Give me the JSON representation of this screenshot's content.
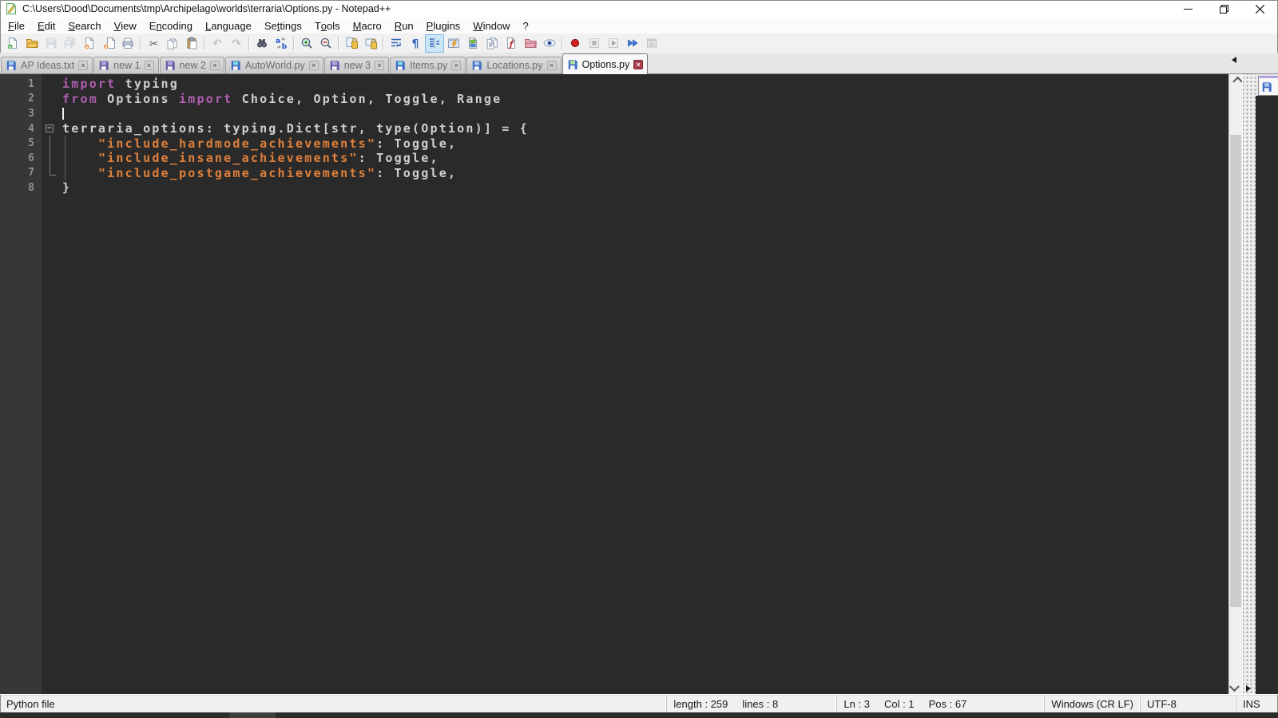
{
  "window": {
    "title": "C:\\Users\\Dood\\Documents\\tmp\\Archipelago\\worlds\\terraria\\Options.py - Notepad++",
    "controls": [
      "minimize-button",
      "restore-button",
      "close-button"
    ]
  },
  "menubar": {
    "items": [
      {
        "label": "File",
        "mnemonic": 0
      },
      {
        "label": "Edit",
        "mnemonic": 0
      },
      {
        "label": "Search",
        "mnemonic": 0
      },
      {
        "label": "View",
        "mnemonic": 0
      },
      {
        "label": "Encoding",
        "mnemonic": 1
      },
      {
        "label": "Language",
        "mnemonic": 0
      },
      {
        "label": "Settings",
        "mnemonic": 2
      },
      {
        "label": "Tools",
        "mnemonic": 1
      },
      {
        "label": "Macro",
        "mnemonic": 0
      },
      {
        "label": "Run",
        "mnemonic": 0
      },
      {
        "label": "Plugins",
        "mnemonic": 0
      },
      {
        "label": "Window",
        "mnemonic": 0
      },
      {
        "label": "?",
        "mnemonic": -1
      }
    ]
  },
  "toolbar": {
    "items": [
      {
        "icon": "new-file"
      },
      {
        "icon": "open-file"
      },
      {
        "icon": "save-file",
        "disabled": true
      },
      {
        "icon": "save-all",
        "disabled": true
      },
      {
        "icon": "close-file"
      },
      {
        "icon": "close-all"
      },
      {
        "icon": "print"
      },
      {
        "sep": true
      },
      {
        "icon": "cut"
      },
      {
        "icon": "copy"
      },
      {
        "icon": "paste"
      },
      {
        "sep": true
      },
      {
        "icon": "undo",
        "disabled": true
      },
      {
        "icon": "redo",
        "disabled": true
      },
      {
        "sep": true
      },
      {
        "icon": "find"
      },
      {
        "icon": "replace"
      },
      {
        "sep": true
      },
      {
        "icon": "zoom-in"
      },
      {
        "icon": "zoom-out"
      },
      {
        "sep": true
      },
      {
        "icon": "sync-vertical"
      },
      {
        "icon": "sync-horizontal"
      },
      {
        "sep": true
      },
      {
        "icon": "word-wrap"
      },
      {
        "icon": "show-all-characters"
      },
      {
        "icon": "show-indent-guide",
        "active": true
      },
      {
        "icon": "udl-dialog"
      },
      {
        "icon": "document-map"
      },
      {
        "icon": "document-list"
      },
      {
        "icon": "function-list"
      },
      {
        "icon": "folder-as-workspace"
      },
      {
        "icon": "monitoring"
      },
      {
        "sep": true
      },
      {
        "icon": "macro-record"
      },
      {
        "icon": "macro-stop",
        "disabled": true
      },
      {
        "icon": "macro-play",
        "disabled": true
      },
      {
        "icon": "macro-run-multiple"
      },
      {
        "icon": "macro-save",
        "disabled": true
      }
    ]
  },
  "tabbar": {
    "tabs": [
      {
        "label": "AP Ideas.txt",
        "floppy": "blue",
        "active": false
      },
      {
        "label": "new 1",
        "floppy": "purple",
        "active": false
      },
      {
        "label": "new 2",
        "floppy": "purple",
        "active": false
      },
      {
        "label": "AutoWorld.py",
        "floppy": "teal",
        "active": false
      },
      {
        "label": "new 3",
        "floppy": "purple",
        "active": false
      },
      {
        "label": "Items.py",
        "floppy": "teal",
        "active": false
      },
      {
        "label": "Locations.py",
        "floppy": "blue",
        "active": false
      },
      {
        "label": "Options.py",
        "floppy": "green",
        "active": true
      }
    ],
    "close_glyph": "×"
  },
  "editor": {
    "caret_line": 3,
    "lines": [
      {
        "num": "1",
        "tokens": [
          {
            "t": "import",
            "c": "kw"
          },
          {
            "t": " typing",
            "c": "def"
          }
        ]
      },
      {
        "num": "2",
        "tokens": [
          {
            "t": "from",
            "c": "kw"
          },
          {
            "t": " Options ",
            "c": "def"
          },
          {
            "t": "import",
            "c": "kw"
          },
          {
            "t": " Choice, Option, Toggle, Range",
            "c": "def"
          }
        ]
      },
      {
        "num": "3",
        "tokens": []
      },
      {
        "num": "4",
        "fold": "start",
        "tokens": [
          {
            "t": "terraria_options: typing.Dict[str, type(Option)] = {",
            "c": "def"
          }
        ]
      },
      {
        "num": "5",
        "fold": "line",
        "tokens": [
          {
            "t": "    ",
            "c": "def"
          },
          {
            "t": "\"include_hardmode_achievements\"",
            "c": "str"
          },
          {
            "t": ": Toggle,",
            "c": "def"
          }
        ]
      },
      {
        "num": "6",
        "fold": "line",
        "tokens": [
          {
            "t": "    ",
            "c": "def"
          },
          {
            "t": "\"include_insane_achievements\"",
            "c": "str"
          },
          {
            "t": ": Toggle,",
            "c": "def"
          }
        ]
      },
      {
        "num": "7",
        "fold": "end",
        "tokens": [
          {
            "t": "    ",
            "c": "def"
          },
          {
            "t": "\"include_postgame_achievements\"",
            "c": "str"
          },
          {
            "t": ": Toggle,",
            "c": "def"
          }
        ]
      },
      {
        "num": "8",
        "tokens": [
          {
            "t": "}",
            "c": "def"
          }
        ]
      }
    ],
    "fold_minus_glyph": "−"
  },
  "statusbar": {
    "doc_type": "Python file",
    "length_lines": "length : 259     lines : 8",
    "cursor": "Ln : 3     Col : 1     Pos : 67",
    "eol": "Windows (CR LF)",
    "encoding": "UTF-8",
    "typing_mode": "INS"
  },
  "colors": {
    "editor_bg": "#2a2a2a",
    "gutter_bg": "#373737",
    "keyword": "#b05eb0",
    "identifier": "#d0d0d0",
    "string": "#e0803a",
    "accent_active_tab_topbar": "#b2a1dd",
    "floppy": {
      "blue": {
        "body": "#3f6cc4",
        "label": "#a9cbf0"
      },
      "purple": {
        "body": "#6b5ba6",
        "label": "#b4a6dc"
      },
      "teal": {
        "body": "#3f6cc4",
        "label": "#7fd8d4"
      },
      "green": {
        "body": "#3f6cc4",
        "label": "#b2e39a"
      }
    }
  }
}
